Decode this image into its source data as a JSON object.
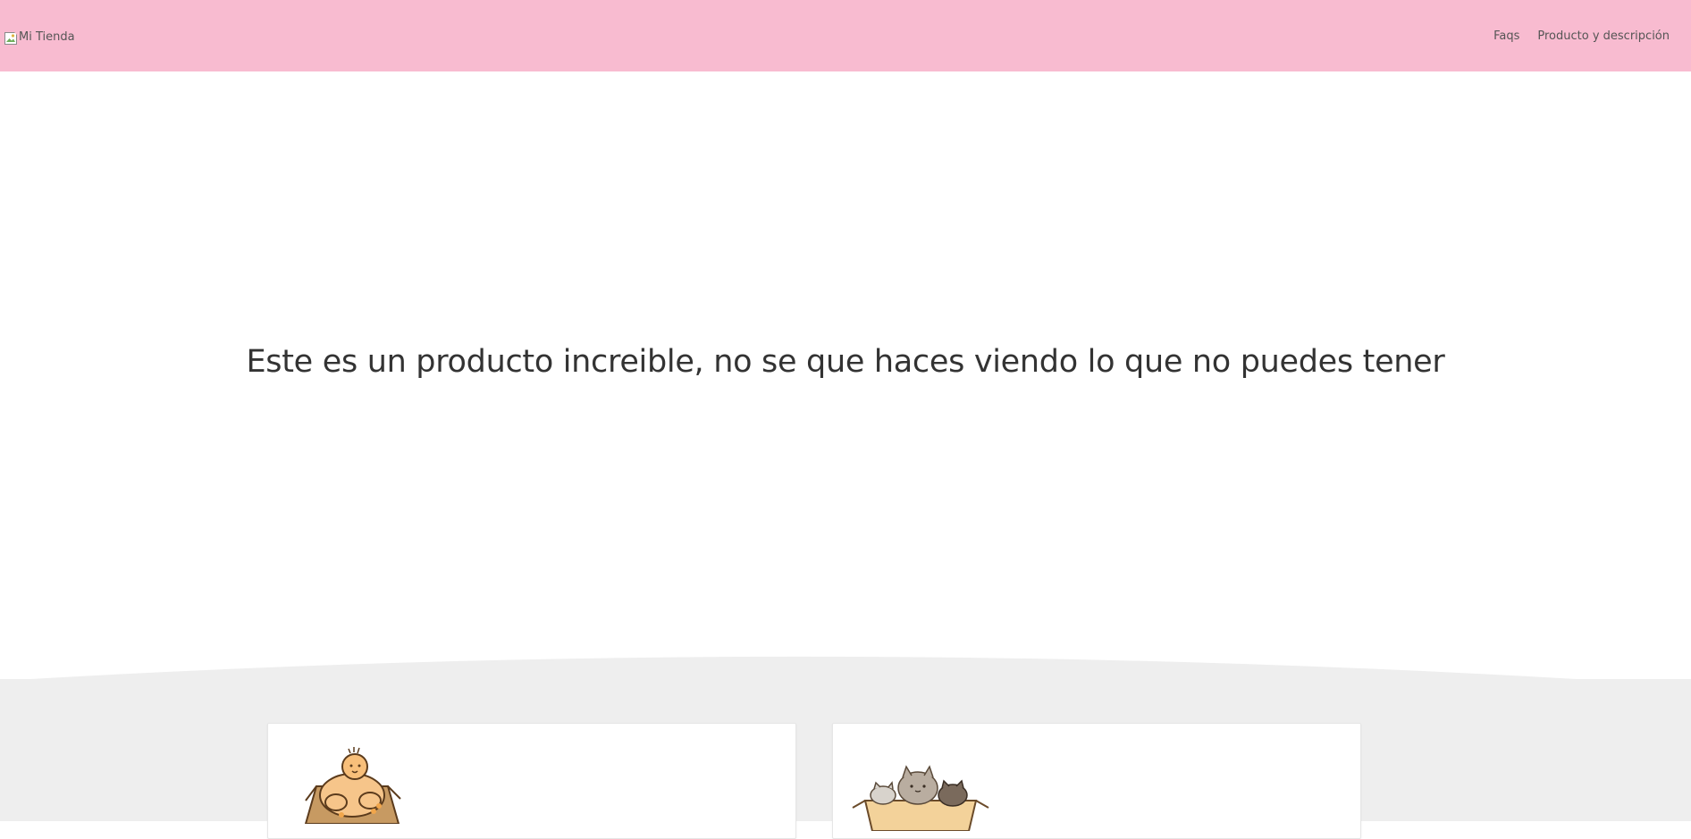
{
  "navbar": {
    "brand_alt": "Mi Tienda",
    "links": [
      "Faqs",
      "Producto y descripción"
    ]
  },
  "hero": {
    "title": "Este es un producto increible, no se que haces viendo lo que no puedes tener"
  },
  "cards": [
    {
      "image": "buddha-box-illustration"
    },
    {
      "image": "cats-in-box-illustration"
    }
  ],
  "colors": {
    "navbar_bg": "#f8bbd0",
    "section_bg": "#eeeeee",
    "text": "#333333"
  }
}
